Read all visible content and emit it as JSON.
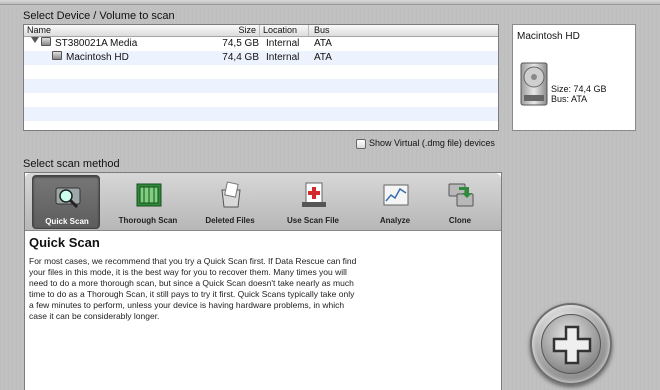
{
  "device_section": {
    "label": "Select Device / Volume to scan",
    "columns": {
      "name": "Name",
      "size": "Size",
      "location": "Location",
      "bus": "Bus"
    },
    "rows": [
      {
        "name": "ST380021A Media",
        "size": "74,5 GB",
        "location": "Internal",
        "bus": "ATA"
      },
      {
        "name": "Macintosh HD",
        "size": "74,4 GB",
        "location": "Internal",
        "bus": "ATA"
      }
    ]
  },
  "info_box": {
    "title": "Macintosh HD",
    "size": "Size: 74,4 GB",
    "bus": "Bus: ATA"
  },
  "virtual_checkbox": {
    "label": "Show Virtual (.dmg file) devices",
    "checked": false
  },
  "scan_method": {
    "label": "Select scan method",
    "tools": [
      {
        "label": "Quick Scan",
        "icon": "quick-scan-icon",
        "selected": true
      },
      {
        "label": "Thorough Scan",
        "icon": "thorough-scan-icon",
        "selected": false
      },
      {
        "label": "Deleted Files",
        "icon": "deleted-files-icon",
        "selected": false
      },
      {
        "label": "Use Scan File",
        "icon": "scan-file-icon",
        "selected": false
      },
      {
        "label": "Analyze",
        "icon": "analyze-icon",
        "selected": false
      },
      {
        "label": "Clone",
        "icon": "clone-icon",
        "selected": false
      }
    ],
    "description_title": "Quick Scan",
    "description": "For most cases, we recommend that you try a Quick Scan first. If Data Rescue can find your files in this mode, it is the best way for you to recover them. Many times you will need to do a more thorough scan, but since a Quick Scan doesn't take nearly as much time to do as a Thorough Scan, it still pays to try it first. Quick Scans typically take only a few minutes to perform, unless your device is having hardware problems, in which case it can be considerably longer."
  },
  "colors": {
    "selection": "#edf3fe",
    "selected_tool": "#666666",
    "red_cross": "#d42a2a",
    "green": "#2e8b3a"
  }
}
